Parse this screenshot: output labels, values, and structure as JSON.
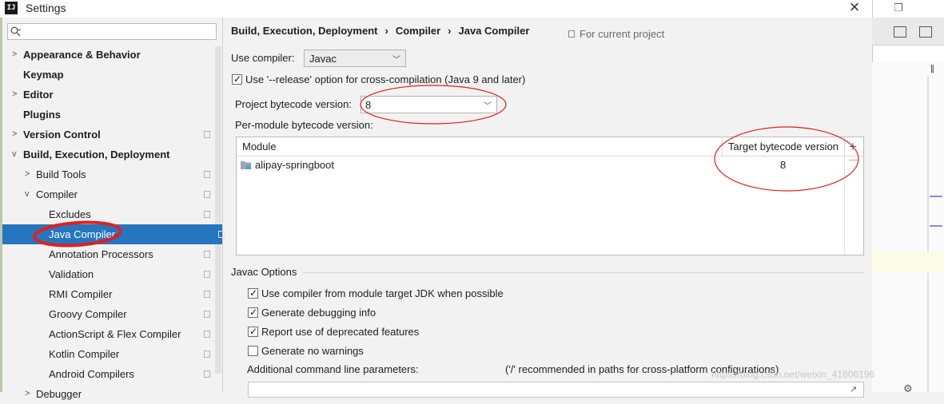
{
  "window": {
    "title": "Settings",
    "app_icon_text": "IJ"
  },
  "sidebar": {
    "search_placeholder": "",
    "items": [
      {
        "label": "Appearance & Behavior"
      },
      {
        "label": "Keymap"
      },
      {
        "label": "Editor"
      },
      {
        "label": "Plugins"
      },
      {
        "label": "Version Control"
      },
      {
        "label": "Build, Execution, Deployment"
      },
      {
        "label": "Build Tools"
      },
      {
        "label": "Compiler"
      },
      {
        "label": "Excludes"
      },
      {
        "label": "Java Compiler"
      },
      {
        "label": "Annotation Processors"
      },
      {
        "label": "Validation"
      },
      {
        "label": "RMI Compiler"
      },
      {
        "label": "Groovy Compiler"
      },
      {
        "label": "ActionScript & Flex Compiler"
      },
      {
        "label": "Kotlin Compiler"
      },
      {
        "label": "Android Compilers"
      },
      {
        "label": "Debugger"
      }
    ]
  },
  "breadcrumb": {
    "part1": "Build, Execution, Deployment",
    "part2": "Compiler",
    "part3": "Java Compiler",
    "separator": "›",
    "scope": "For current project"
  },
  "form": {
    "use_compiler_label": "Use compiler:",
    "use_compiler_value": "Javac",
    "release_option_label": "Use '--release' option for cross-compilation (Java 9 and later)",
    "release_option_checked": true,
    "bytecode_label": "Project bytecode version:",
    "bytecode_value": "8",
    "per_module_label": "Per-module bytecode version:"
  },
  "module_table": {
    "columns": [
      "Module",
      "Target bytecode version"
    ],
    "rows": [
      {
        "module": "alipay-springboot",
        "target": "8"
      }
    ]
  },
  "javac_options": {
    "title": "Javac Options",
    "checkboxes": [
      {
        "label": "Use compiler from module target JDK when possible",
        "checked": true
      },
      {
        "label": "Generate debugging info",
        "checked": true
      },
      {
        "label": "Report use of deprecated features",
        "checked": true
      },
      {
        "label": "Generate no warnings",
        "checked": false
      }
    ],
    "additional_label": "Additional command line parameters:",
    "additional_hint": "('/' recommended in paths for cross-platform configurations)",
    "additional_value": ""
  },
  "watermark": "https://blog.csdn.net/weixin_41806196",
  "colors": {
    "selection": "#2675bf",
    "annotation": "#e0201e",
    "highlight_mark": "#8a8ae6"
  }
}
